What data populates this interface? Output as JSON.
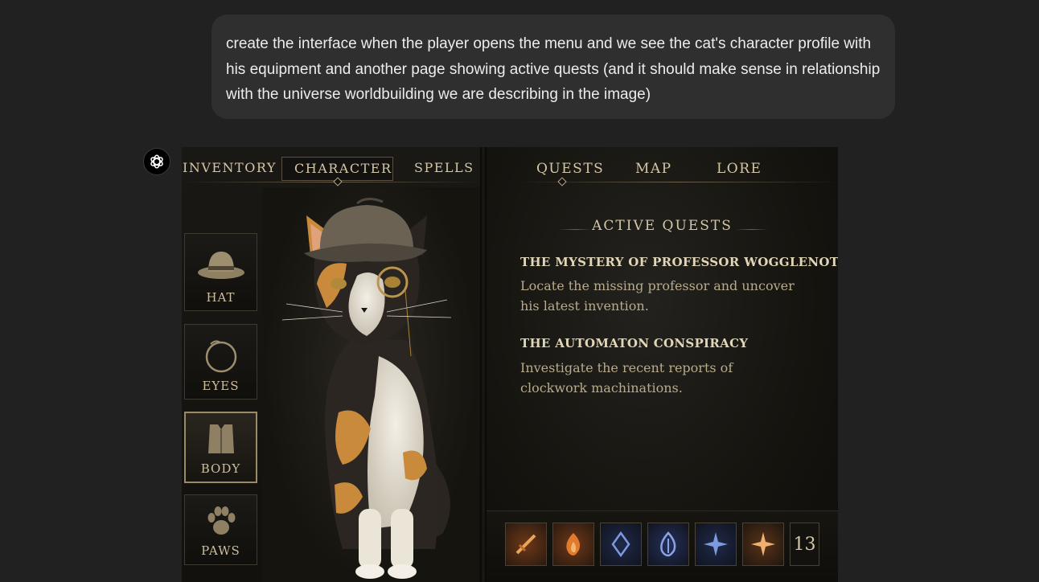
{
  "chat": {
    "user_prompt": "create the interface when the player opens the menu and we see the cat's character profile with his equipment and another page showing active quests (and it should make sense in relationship with the universe worldbuilding we are describing in the image)"
  },
  "assistant": {
    "avatar_icon": "openai-logo-icon"
  },
  "game_ui": {
    "left_tabs": [
      "INVENTORY",
      "CHARACTER",
      "SPELLS"
    ],
    "active_left_tab": "CHARACTER",
    "right_tabs": [
      "QUESTS",
      "MAP",
      "LORE"
    ],
    "active_right_tab": "QUESTS",
    "equipment_slots": [
      {
        "label": "HAT",
        "icon": "deerstalker-hat-icon"
      },
      {
        "label": "EYES",
        "icon": "monocle-icon"
      },
      {
        "label": "BODY",
        "icon": "coat-icon",
        "selected": true
      },
      {
        "label": "PAWS",
        "icon": "paw-print-icon"
      }
    ],
    "character_portrait": "calico-cat-detective-portrait",
    "quests_heading": "ACTIVE QUESTS",
    "quests": [
      {
        "title": "THE MYSTERY OF PROFESSOR WOGGLENOT",
        "description": "Locate the missing professor and uncover his latest invention."
      },
      {
        "title": "THE AUTOMATON CONSPIRACY",
        "description": "Investigate the recent reports of clockwork machinations."
      }
    ],
    "skills": [
      "sword-skill-icon",
      "flame-skill-icon",
      "arcane-rune-icon",
      "blue-flame-icon",
      "star-rune-icon",
      "amber-star-icon"
    ],
    "skill_count": "13",
    "colors": {
      "gold_text": "#d4c7a6",
      "panel_bg": "#15140f",
      "chat_bg": "#212121",
      "bubble_bg": "#2f2f2f"
    }
  }
}
